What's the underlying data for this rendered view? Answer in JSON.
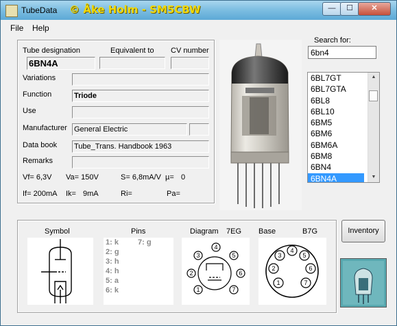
{
  "window": {
    "title": "TubeData",
    "credit": "© Åke Holm - SM5CBW",
    "min_glyph": "—",
    "max_glyph": "☐",
    "close_glyph": "✕"
  },
  "menu": {
    "file": "File",
    "help": "Help"
  },
  "details": {
    "designation_label": "Tube designation",
    "equivalent_label": "Equivalent to",
    "cv_label": "CV number",
    "designation_value": "6BN4A",
    "equivalent_value": "",
    "cv_value": "",
    "variations_label": "Variations",
    "variations_value": "",
    "function_label": "Function",
    "function_value": "Triode",
    "use_label": "Use",
    "use_value": "",
    "manufacturer_label": "Manufacturer",
    "manufacturer_value": "General Electric",
    "manufacturer_extra": "",
    "databook_label": "Data book",
    "databook_value": "Tube_Trans. Handbook 1963",
    "remarks_label": "Remarks",
    "remarks_value": ""
  },
  "specs": {
    "vf": "Vf= 6,3V",
    "va": "Va= 150V",
    "s": "S= 6,8mA/V",
    "mu": "µ=",
    "mu_value": "0",
    "if": "If= 200mA",
    "ik": "Ik=",
    "ik_value": "9mA",
    "ri": "Ri=",
    "pa": "Pa="
  },
  "search": {
    "label": "Search for:",
    "value": "6bn4",
    "results": [
      "6BL7GT",
      "6BL7GTA",
      "6BL8",
      "6BL10",
      "6BM5",
      "6BM6",
      "6BM6A",
      "6BM8",
      "6BN4",
      "6BN4A"
    ],
    "selected": "6BN4A"
  },
  "lower": {
    "symbol_label": "Symbol",
    "pins_label": "Pins",
    "diagram_label": "Diagram",
    "diagram_code": "7EG",
    "base_label": "Base",
    "base_code": "B7G",
    "pins": [
      "1: k",
      "2: g",
      "3: h",
      "4: h",
      "5: a",
      "6: k"
    ],
    "pin7": "7: g",
    "base_pins": [
      "1",
      "2",
      "3",
      "4",
      "5",
      "6",
      "7"
    ]
  },
  "buttons": {
    "inventory": "Inventory"
  },
  "colors": {
    "selection": "#3399ff",
    "title_credit": "#f0d800"
  }
}
